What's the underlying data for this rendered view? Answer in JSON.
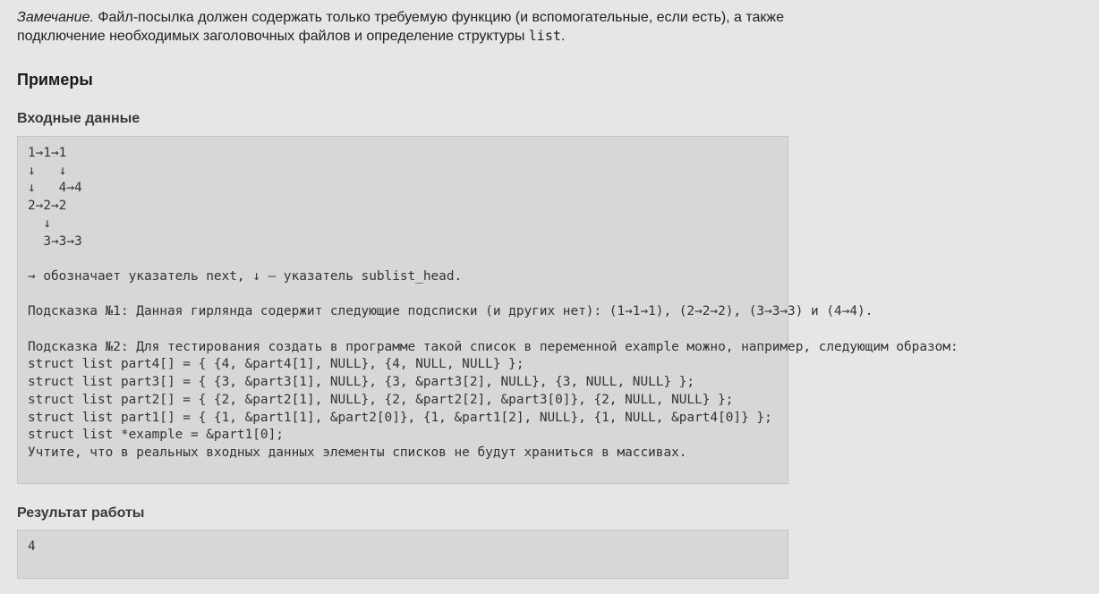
{
  "note": {
    "label": "Замечание.",
    "text_part1": " Файл-посылка должен содержать только требуемую функцию (и вспомогательные, если есть), а также подключение необходимых заголовочных файлов и определение структуры ",
    "code": "list",
    "text_part2": "."
  },
  "examples": {
    "title": "Примеры",
    "input_label": "Входные данные",
    "input_lines": [
      "1→1→1",
      "↓   ↓",
      "↓   4→4",
      "2→2→2",
      "  ↓",
      "  3→3→3",
      "",
      "→ обозначает указатель next, ↓ — указатель sublist_head.",
      "",
      "Подсказка №1: Данная гирлянда содержит следующие подсписки (и других нет): (1→1→1), (2→2→2), (3→3→3) и (4→4).",
      "",
      "Подсказка №2: Для тестирования создать в программе такой список в переменной example можно, например, следующим образом:",
      "struct list part4[] = { {4, &part4[1], NULL}, {4, NULL, NULL} };",
      "struct list part3[] = { {3, &part3[1], NULL}, {3, &part3[2], NULL}, {3, NULL, NULL} };",
      "struct list part2[] = { {2, &part2[1], NULL}, {2, &part2[2], &part3[0]}, {2, NULL, NULL} };",
      "struct list part1[] = { {1, &part1[1], &part2[0]}, {1, &part1[2], NULL}, {1, NULL, &part4[0]} };",
      "struct list *example = &part1[0];",
      "Учтите, что в реальных входных данных элементы списков не будут храниться в массивах."
    ],
    "output_label": "Результат работы",
    "output_lines": [
      "4"
    ]
  }
}
